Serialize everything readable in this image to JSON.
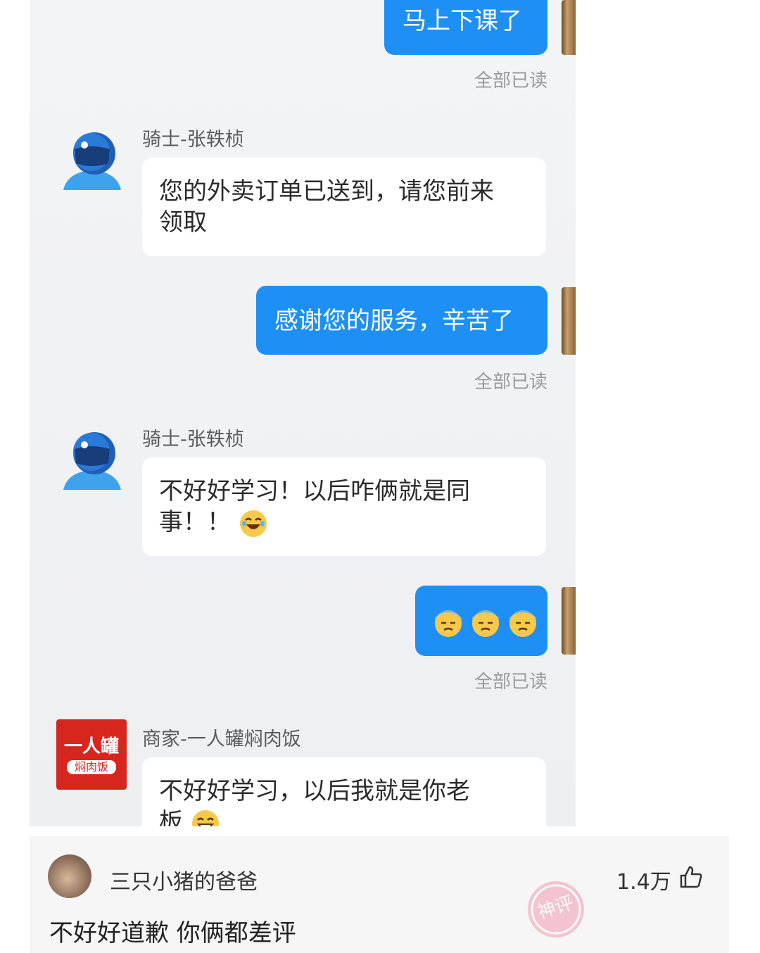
{
  "chat": {
    "messages": [
      {
        "type": "outgoing",
        "text": "马上下课了",
        "status": "全部已读"
      },
      {
        "type": "incoming",
        "sender": "骑士-张轶桢",
        "line1": "您的外卖订单已送到，请您前来",
        "line2": "领取"
      },
      {
        "type": "outgoing",
        "text": "感谢您的服务，辛苦了",
        "status": "全部已读"
      },
      {
        "type": "incoming",
        "sender": "骑士-张轶桢",
        "line1": "不好好学习！以后咋俩就是同",
        "line2": "事！！"
      },
      {
        "type": "outgoing",
        "text": "",
        "status": "全部已读"
      },
      {
        "type": "incoming",
        "sender": "商家-一人罐焖肉饭",
        "line1": "不好好学习，以后我就是你老",
        "line2": "板"
      }
    ],
    "merchant_logo": {
      "line1": "一人罐",
      "line2": "焖肉饭"
    }
  },
  "comment": {
    "user": "三只小猪的爸爸",
    "likes": "1.4万",
    "text": "不好好道歉  你俩都差评",
    "badge": "神评"
  },
  "colors": {
    "accent_blue": "#1e90f5",
    "merchant_red": "#d7261e"
  }
}
